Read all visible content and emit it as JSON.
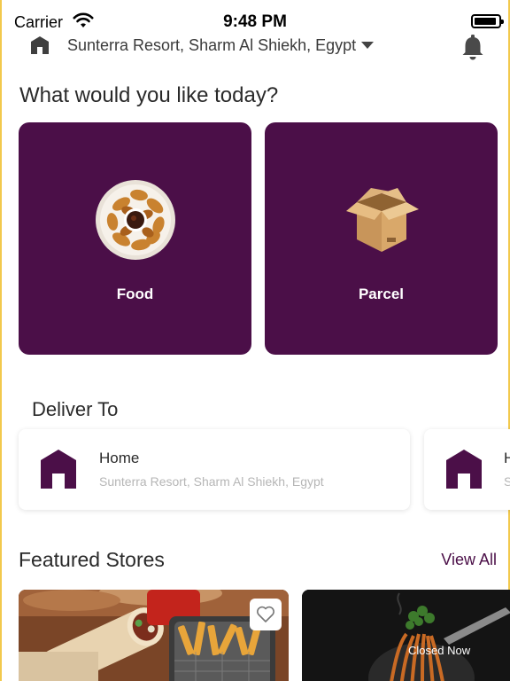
{
  "status_bar": {
    "carrier": "Carrier",
    "time": "9:48 PM"
  },
  "header": {
    "location": "Sunterra Resort, Sharm Al Shiekh, Egypt"
  },
  "question": "What would you like today?",
  "categories": [
    {
      "label": "Food",
      "icon": "fried-chicken-plate"
    },
    {
      "label": "Parcel",
      "icon": "cardboard-box"
    }
  ],
  "deliver_to": {
    "title": "Deliver To",
    "addresses": [
      {
        "name": "Home",
        "address": "Sunterra Resort, Sharm Al Shiekh, Egypt"
      },
      {
        "name": "H",
        "address": "S"
      }
    ]
  },
  "featured": {
    "title": "Featured Stores",
    "view_all": "View All",
    "stores": [
      {
        "image": "wraps-and-fries",
        "favorite_icon": "heart-outline-icon"
      },
      {
        "image": "pasta-dish",
        "status": "Closed Now"
      }
    ]
  },
  "colors": {
    "brand": "#4b0f48",
    "accent_edge": "#f2c94c",
    "muted_text": "#b6b6b6"
  }
}
